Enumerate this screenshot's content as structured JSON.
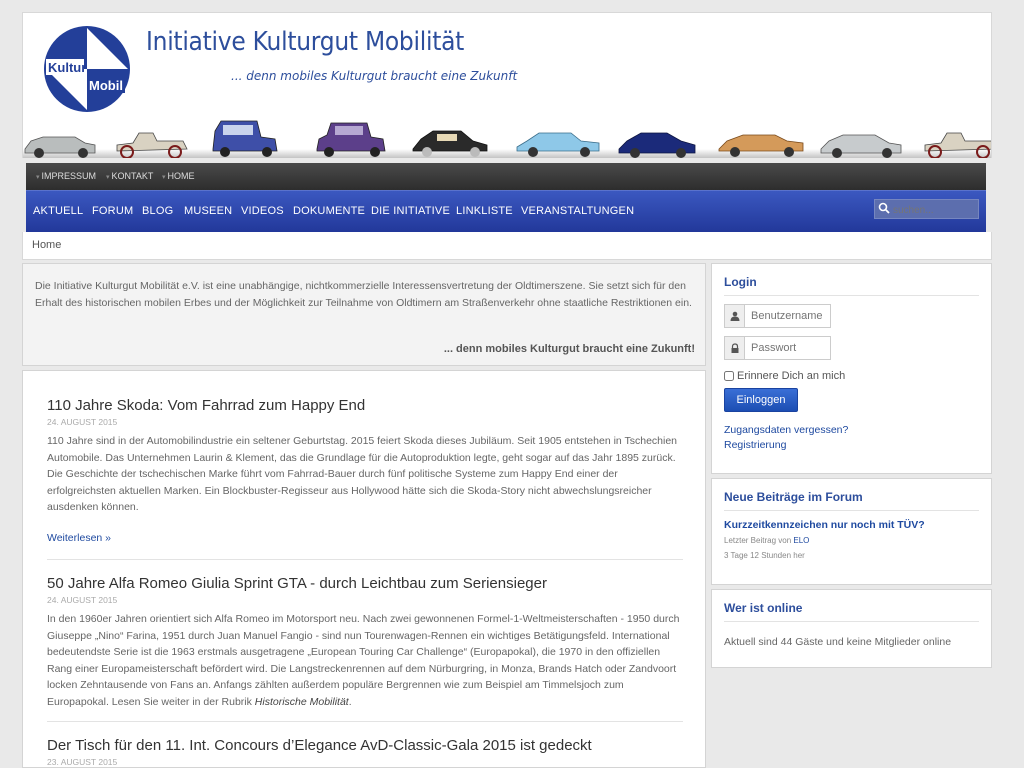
{
  "site": {
    "title": "Initiative Kulturgut Mobilität",
    "slogan": "... denn mobiles Kulturgut braucht eine Zukunft",
    "logo_text_top": "Kultur",
    "logo_text_bottom": "Mobil"
  },
  "colors": {
    "brand_blue": "#2d4e9c",
    "nav_blue": "#2a44a8",
    "link": "#1f4aa0"
  },
  "topnav": [
    "IMPRESSUM",
    "KONTAKT",
    "HOME"
  ],
  "mainnav": [
    "AKTUELL",
    "FORUM",
    "BLOG",
    "MUSEEN",
    "VIDEOS",
    "DOKUMENTE",
    "DIE INITIATIVE",
    "LINKLISTE",
    "VERANSTALTUNGEN"
  ],
  "search": {
    "placeholder": "suchen..."
  },
  "breadcrumb": "Home",
  "intro": {
    "text": "Die Initiative Kulturgut Mobilität e.V. ist eine unabhängige, nichtkommerzielle Interessensvertretung der Oldtimerszene. Sie setzt sich für den Erhalt des historischen mobilen Erbes und der Möglichkeit zur Teilnahme von Oldtimern am Straßenverkehr ohne staatliche Restriktionen ein.",
    "tagline": "... denn mobiles Kulturgut braucht eine Zukunft!"
  },
  "articles": [
    {
      "title": "110 Jahre Skoda: Vom Fahrrad zum Happy End",
      "date": "24. August 2015",
      "body": "110 Jahre sind in der Automobilindustrie ein seltener Geburtstag. 2015 feiert Skoda dieses Jubiläum. Seit 1905 entstehen in Tschechien Automobile. Das Unternehmen Laurin & Klement, das die Grundlage für die Autoproduktion legte, geht sogar auf das Jahr 1895 zurück. Die Geschichte der tschechischen Marke führt vom Fahrrad-Bauer durch fünf politische Systeme zum Happy End einer der erfolgreichsten aktuellen Marken. Ein Blockbuster-Regisseur aus Hollywood hätte sich die Skoda-Story nicht abwechslungsreicher ausdenken können.",
      "more": "Weiterlesen »"
    },
    {
      "title": "50 Jahre Alfa Romeo Giulia Sprint GTA - durch Leichtbau zum Seriensieger",
      "date": "24. August 2015",
      "body": "In den 1960er Jahren orientiert sich Alfa Romeo im Motorsport neu. Nach zwei gewonnenen Formel-1-Weltmeisterschaften - 1950 durch Giuseppe „Nino“ Farina, 1951 durch Juan Manuel Fangio - sind nun Tourenwagen-Rennen ein wichtiges Betätigungsfeld. International bedeutendste Serie ist die 1963 erstmals ausgetragene „European Touring Car Challenge“ (Europapokal), die 1970 in den offiziellen Rang einer Europameisterschaft befördert wird. Die Langstreckenrennen auf dem Nürburgring, in Monza, Brands Hatch oder Zandvoort locken Zehntausende von Fans an. Anfangs zählten außerdem populäre Bergrennen wie zum Beispiel am Timmelsjoch zum Europapokal. Lesen Sie weiter in der Rubrik ",
      "body_em": "Historische Mobilität",
      "body_end": "."
    },
    {
      "title": "Der Tisch für den 11. Int. Concours d’Elegance AvD-Classic-Gala 2015 ist gedeckt",
      "date": "23. August 2015"
    }
  ],
  "login": {
    "title": "Login",
    "username_placeholder": "Benutzername",
    "password_placeholder": "Passwort",
    "remember": "Erinnere Dich an mich",
    "button": "Einloggen",
    "forgot": "Zugangsdaten vergessen?",
    "register": "Registrierung"
  },
  "forum": {
    "title": "Neue Beiträge im Forum",
    "post_title": "Kurzzeitkennzeichen nur noch mit TÜV?",
    "last_post_prefix": "Letzter Beitrag von",
    "last_post_user": "ELO",
    "ago": "3 Tage 12 Stunden her"
  },
  "online": {
    "title": "Wer ist online",
    "text": "Aktuell sind 44 Gäste und keine Mitglieder online"
  }
}
